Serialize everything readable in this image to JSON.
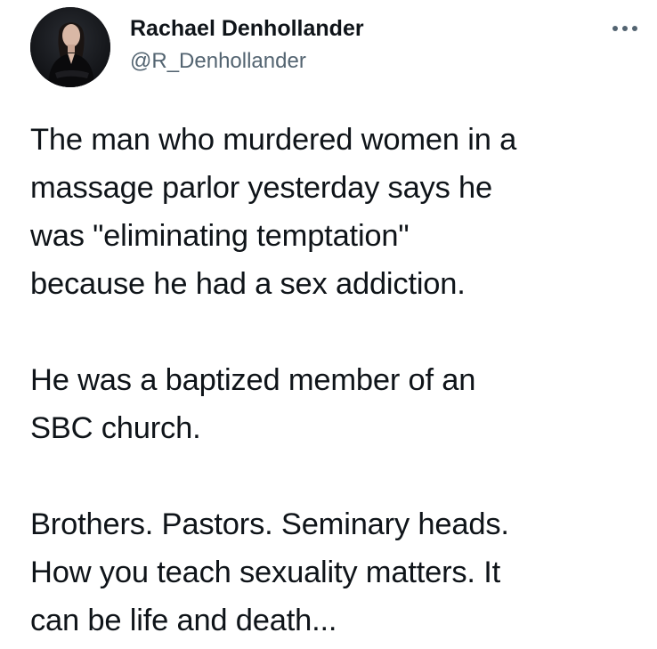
{
  "author": {
    "display_name": "Rachael Denhollander",
    "handle": "@R_Denhollander",
    "avatar_icon": "profile-photo"
  },
  "more_icon": "more-horizontal-icon",
  "tweet": {
    "paragraphs": [
      "The man who murdered women in a\nmassage parlor yesterday says he\nwas \"eliminating temptation\"\nbecause he had a sex addiction.",
      "He was a baptized member of an\nSBC church.",
      "Brothers. Pastors. Seminary heads.\nHow you teach sexuality matters. It\ncan be life and death..."
    ]
  },
  "colors": {
    "text": "#0f1419",
    "secondary_text": "#536471",
    "background": "#ffffff"
  }
}
